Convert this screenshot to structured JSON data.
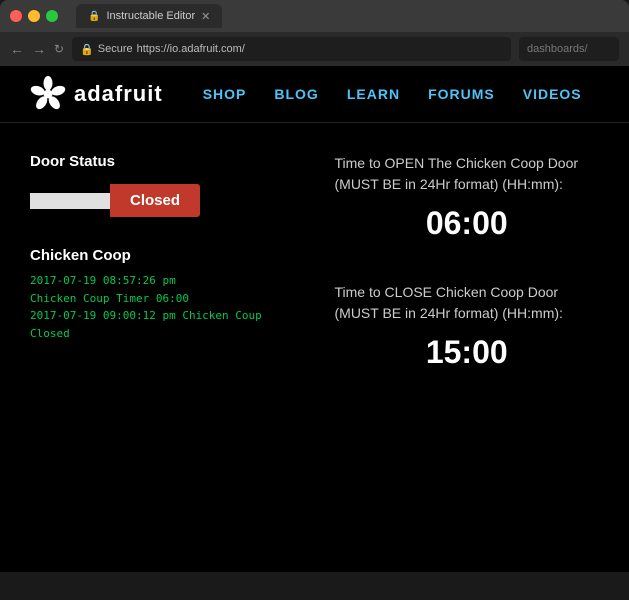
{
  "browser": {
    "traffic_lights": [
      "close",
      "minimize",
      "maximize"
    ],
    "tab_label": "Instructable Editor",
    "tab_favicon": "🔒",
    "url_secure_label": "Secure",
    "url": "https://io.adafruit.com/",
    "url_right": "dashboards/"
  },
  "site": {
    "logo_text": "adafruit",
    "nav": {
      "items": [
        "SHOP",
        "BLOG",
        "LEARN",
        "FORUMS",
        "VIDEOS"
      ]
    }
  },
  "door_status": {
    "section_label": "Door Status",
    "open_label": "",
    "closed_label": "Closed"
  },
  "coop": {
    "title": "Chicken Coop",
    "log_lines": [
      "2017-07-19 08:57:26 pm",
      "Chicken Coup Timer 06:00",
      "2017-07-19 09:00:12 pm Chicken Coup",
      "Closed"
    ]
  },
  "open_time": {
    "label": "Time to OPEN The Chicken Coop Door (MUST BE in 24Hr format) (HH:mm):",
    "value": "06:00"
  },
  "close_time": {
    "label": "Time to CLOSE Chicken Coop Door (MUST BE in 24Hr format) (HH:mm):",
    "value": "15:00"
  }
}
